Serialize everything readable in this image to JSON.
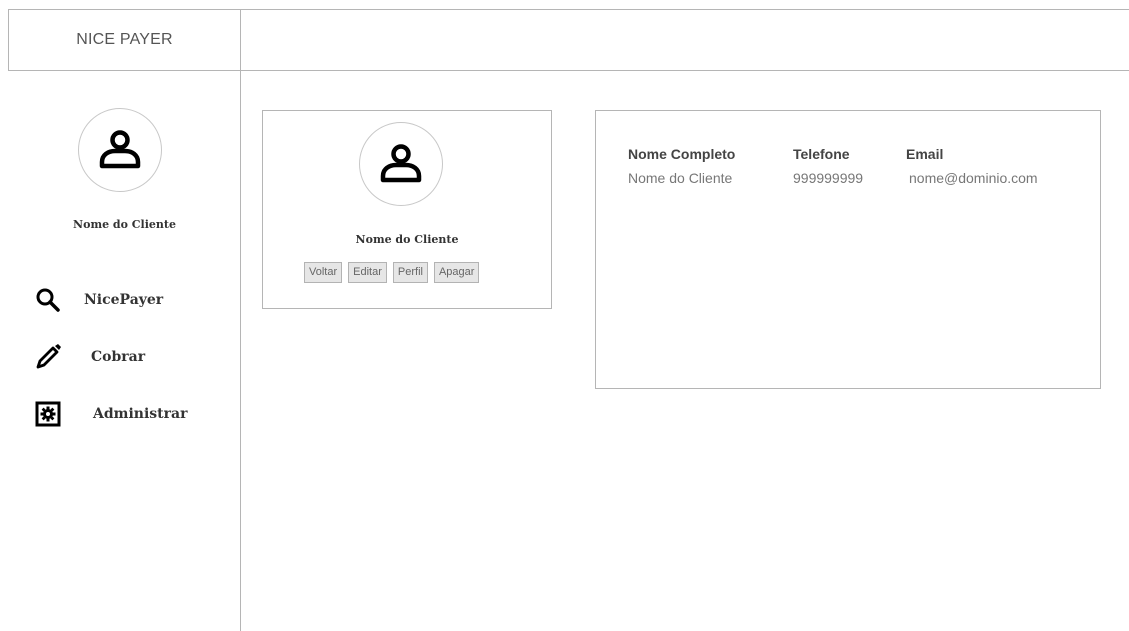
{
  "header": {
    "brand": "NICE PAYER"
  },
  "sidebar": {
    "avatar_icon": "user-icon",
    "client_name": "Nome do Cliente",
    "items": [
      {
        "label": "NicePayer",
        "icon": "search-icon"
      },
      {
        "label": "Cobrar",
        "icon": "pencil-icon"
      },
      {
        "label": "Administrar",
        "icon": "gear-icon"
      }
    ]
  },
  "profile_card": {
    "avatar_icon": "user-icon",
    "client_name": "Nome do Cliente",
    "buttons": [
      "Voltar",
      "Editar",
      "Perfil",
      "Apagar"
    ]
  },
  "info_card": {
    "columns": [
      {
        "header": "Nome Completo",
        "value": "Nome do Cliente"
      },
      {
        "header": "Telefone",
        "value": "999999999"
      },
      {
        "header": "Email",
        "value": "nome@dominio.com"
      }
    ]
  }
}
